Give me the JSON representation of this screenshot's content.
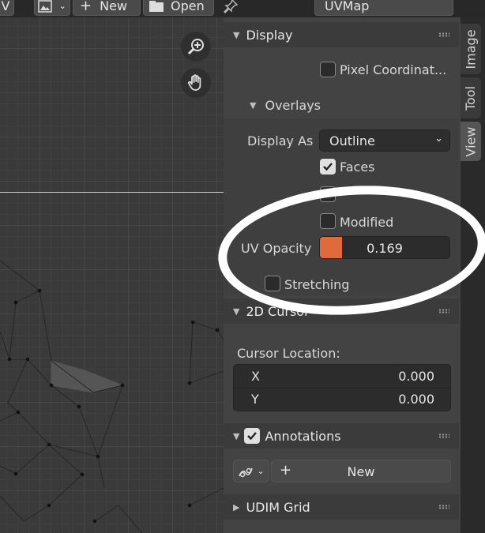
{
  "topbar": {
    "left_stub": "V",
    "new_label": "New",
    "open_label": "Open",
    "uvmap_label": "UVMap"
  },
  "display_panel": {
    "title": "Display",
    "pixel_coordinates_label": "Pixel Coordinat..."
  },
  "overlays": {
    "title": "Overlays",
    "display_as_label": "Display As",
    "display_as_value": "Outline",
    "faces_label": "Faces",
    "modified_label": "Modified",
    "uv_opacity_label": "UV Opacity",
    "uv_opacity_value": "0.169",
    "uv_opacity_fraction": 0.169,
    "stretching_label": "Stretching"
  },
  "cursor_panel": {
    "title": "2D Cursor",
    "location_label": "Cursor Location:",
    "x_label": "X",
    "x_value": "0.000",
    "y_label": "Y",
    "y_value": "0.000"
  },
  "annotations_panel": {
    "title": "Annotations",
    "new_label": "New"
  },
  "udim_panel": {
    "title": "UDIM Grid"
  },
  "tabs": {
    "image": "Image",
    "tool": "Tool",
    "view": "View"
  },
  "colors": {
    "accent": "#e06a3b",
    "panel": "#434343",
    "header": "#3b3b3b",
    "field": "#2c2c2c"
  }
}
